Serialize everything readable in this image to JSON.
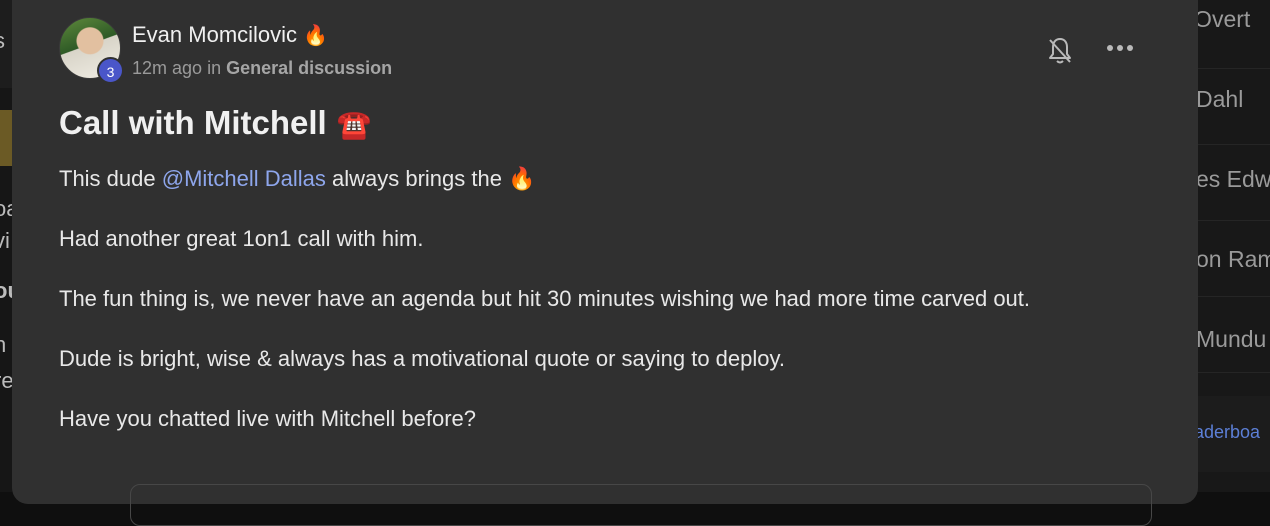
{
  "post": {
    "author": "Evan Momcilovic",
    "author_emoji": "🔥",
    "level": "3",
    "time": "12m ago",
    "in_word": "in",
    "channel": "General discussion",
    "title": "Call with Mitchell",
    "title_emoji": "☎️",
    "body": {
      "p1_before": "This dude ",
      "p1_mention": "@Mitchell Dallas",
      "p1_after": " always brings the ",
      "p1_emoji": "🔥",
      "p2": "Had another great 1on1 call with him.",
      "p3": "The fun thing is, we never have an agenda but hit 30 minutes wishing we had more time carved out.",
      "p4": "Dude is bright, wise & always has a motivational quote or saying to deploy.",
      "p5": "Have you chatted live with Mitchell before?"
    },
    "icons": {
      "bell": "bell-icon",
      "more": "more-options-icon"
    }
  },
  "background": {
    "left_fragments": [
      "s",
      "oa",
      "vi",
      "ou",
      "h",
      "re"
    ],
    "right_fragments": [
      "r Overt",
      "Dahl",
      "es Edwa",
      "on Ram",
      "Mundu"
    ],
    "right_link": "aderboa"
  },
  "colors": {
    "card": "#303030",
    "mention": "#8ea6ec",
    "badge": "#4a56c9",
    "link": "#5c7fd6"
  }
}
